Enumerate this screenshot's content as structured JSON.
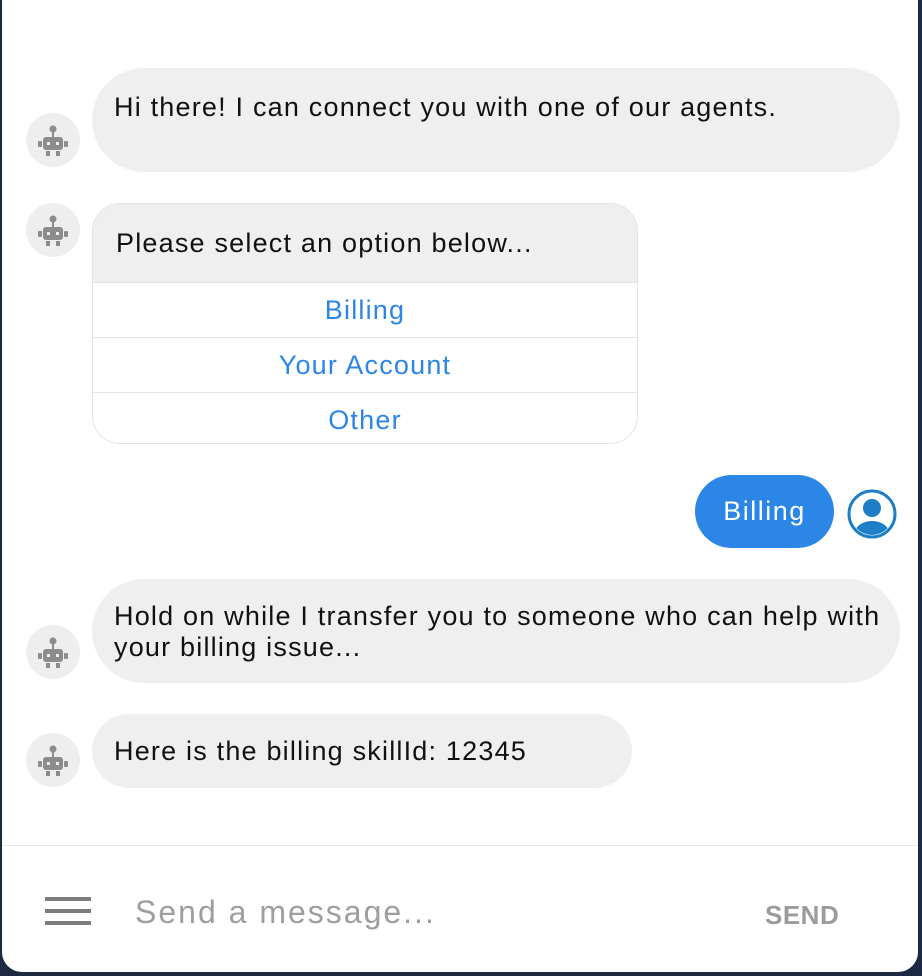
{
  "messages": [
    {
      "from": "bot",
      "text": "Hi there! I can connect you with one of our agents."
    },
    {
      "from": "bot",
      "type": "options",
      "prompt": "Please select an option below...",
      "options": [
        "Billing",
        "Your Account",
        "Other"
      ]
    },
    {
      "from": "user",
      "text": "Billing"
    },
    {
      "from": "bot",
      "text": "Hold on while I transfer you to someone who can help with your billing issue..."
    },
    {
      "from": "bot",
      "text": "Here is the billing skillId: 12345"
    }
  ],
  "composer": {
    "placeholder": "Send a message...",
    "send_label": "SEND"
  },
  "colors": {
    "accent": "#2b86e6",
    "bot_bubble": "#efefef",
    "frame": "#1c2a44"
  },
  "icons": {
    "bot": "robot-icon",
    "user": "user-avatar-icon",
    "menu": "hamburger-menu-icon"
  }
}
